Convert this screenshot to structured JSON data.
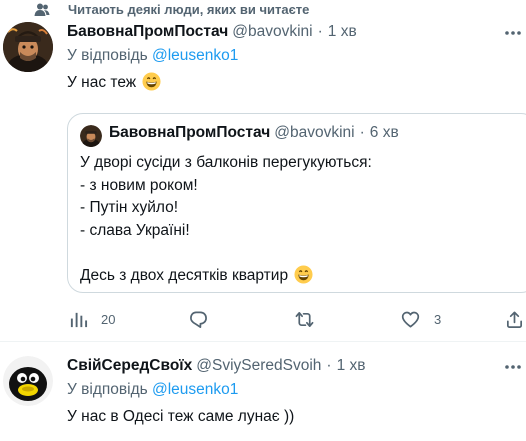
{
  "social_context": {
    "icon": "people-icon",
    "text": "Читають деякі люди, яких ви читаєте"
  },
  "tweet1": {
    "display_name": "БавовнаПромПостач",
    "handle": "@bavovkini",
    "dot": "·",
    "time": "1 хв",
    "reply_prefix": "У відповідь ",
    "reply_mention": "@leusenko1",
    "text": "У нас теж"
  },
  "quote": {
    "display_name": "БавовнаПромПостач",
    "handle": "@bavovkini",
    "dot": "·",
    "time": "6 хв",
    "lines": [
      "У дворі сусіди з балконів перегукуються:",
      "- з новим роком!",
      "- Путін хуйло!",
      "- слава Україні!",
      "",
      "Десь з двох десятків квартир"
    ]
  },
  "actions": {
    "views": "20",
    "retweets": "",
    "likes": "3"
  },
  "tweet2": {
    "display_name": "СвійСередСвоїх",
    "handle": "@SviySeredSvoih",
    "dot": "·",
    "time": "1 хв",
    "reply_prefix": "У відповідь ",
    "reply_mention": "@leusenko1",
    "text": "У нас в Одесі теж саме лунає ))"
  },
  "colors": {
    "text": "#0f1419",
    "secondary": "#536471",
    "link": "#1d9bf0",
    "border": "#cfd9de"
  }
}
